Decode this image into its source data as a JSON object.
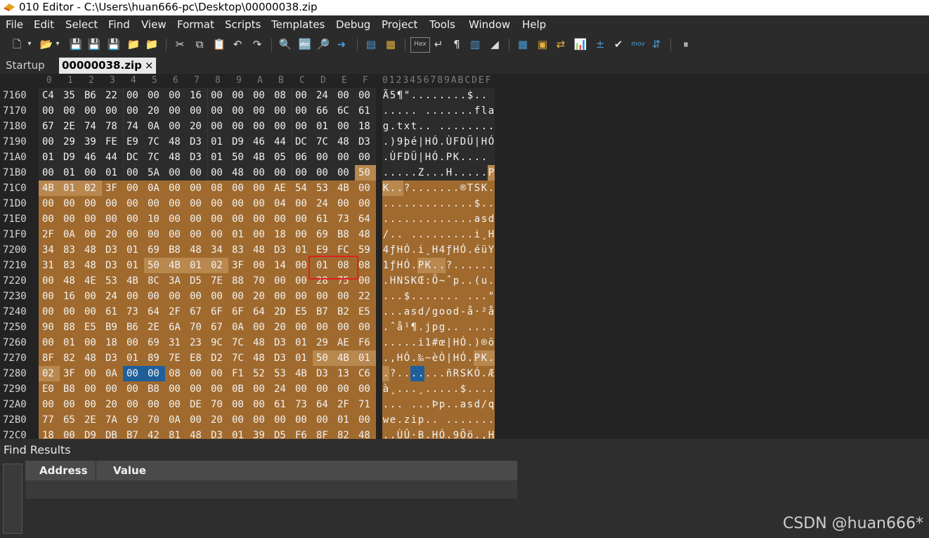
{
  "window": {
    "title": "010 Editor - C:\\Users\\huan666-pc\\Desktop\\00000038.zip"
  },
  "menu": [
    "File",
    "Edit",
    "Select",
    "Find",
    "View",
    "Format",
    "Scripts",
    "Templates",
    "Debug",
    "Project",
    "Tools",
    "Window",
    "Help"
  ],
  "toolbar": {
    "hex_label": "Hex",
    "mov_label": "mov"
  },
  "tabs": {
    "startup": "Startup",
    "active": "00000038.zip",
    "close_glyph": "×"
  },
  "hex": {
    "col_headers": [
      "0",
      "1",
      "2",
      "3",
      "4",
      "5",
      "6",
      "7",
      "8",
      "9",
      "A",
      "B",
      "C",
      "D",
      "E",
      "F"
    ],
    "ascii_header": "0123456789ABCDEF",
    "rows": [
      {
        "addr": "7160",
        "bytes": [
          "C4",
          "35",
          "B6",
          "22",
          "00",
          "00",
          "00",
          "16",
          "00",
          "00",
          "00",
          "08",
          "00",
          "24",
          "00",
          "00"
        ],
        "ascii": "Ä5¶\"........$.."
      },
      {
        "addr": "7170",
        "bytes": [
          "00",
          "00",
          "00",
          "00",
          "00",
          "20",
          "00",
          "00",
          "00",
          "00",
          "00",
          "00",
          "00",
          "66",
          "6C",
          "61"
        ],
        "ascii": "..... .......fla"
      },
      {
        "addr": "7180",
        "bytes": [
          "67",
          "2E",
          "74",
          "78",
          "74",
          "0A",
          "00",
          "20",
          "00",
          "00",
          "00",
          "00",
          "00",
          "01",
          "00",
          "18"
        ],
        "ascii": "g.txt.. ........"
      },
      {
        "addr": "7190",
        "bytes": [
          "00",
          "29",
          "39",
          "FE",
          "E9",
          "7C",
          "48",
          "D3",
          "01",
          "D9",
          "46",
          "44",
          "DC",
          "7C",
          "48",
          "D3"
        ],
        "ascii": ".)9þé|HÓ.ÙFDÜ|HÓ"
      },
      {
        "addr": "71A0",
        "bytes": [
          "01",
          "D9",
          "46",
          "44",
          "DC",
          "7C",
          "48",
          "D3",
          "01",
          "50",
          "4B",
          "05",
          "06",
          "00",
          "00",
          "00"
        ],
        "ascii": ".ÙFDÜ|HÓ.PK...."
      },
      {
        "addr": "71B0",
        "bytes": [
          "00",
          "01",
          "00",
          "01",
          "00",
          "5A",
          "00",
          "00",
          "00",
          "48",
          "00",
          "00",
          "00",
          "00",
          "00",
          "50"
        ],
        "ascii": ".....Z...H.....P"
      },
      {
        "addr": "71C0",
        "bytes": [
          "4B",
          "01",
          "02",
          "3F",
          "00",
          "0A",
          "00",
          "00",
          "08",
          "00",
          "00",
          "AE",
          "54",
          "53",
          "4B",
          "00"
        ],
        "ascii": "K..?.......®TSK."
      },
      {
        "addr": "71D0",
        "bytes": [
          "00",
          "00",
          "00",
          "00",
          "00",
          "00",
          "00",
          "00",
          "00",
          "00",
          "00",
          "04",
          "00",
          "24",
          "00",
          "00"
        ],
        "ascii": ".............$.."
      },
      {
        "addr": "71E0",
        "bytes": [
          "00",
          "00",
          "00",
          "00",
          "00",
          "10",
          "00",
          "00",
          "00",
          "00",
          "00",
          "00",
          "00",
          "61",
          "73",
          "64"
        ],
        "ascii": ".............asd"
      },
      {
        "addr": "71F0",
        "bytes": [
          "2F",
          "0A",
          "00",
          "20",
          "00",
          "00",
          "00",
          "00",
          "00",
          "01",
          "00",
          "18",
          "00",
          "69",
          "B8",
          "48"
        ],
        "ascii": "/.. .........i¸H"
      },
      {
        "addr": "7200",
        "bytes": [
          "34",
          "83",
          "48",
          "D3",
          "01",
          "69",
          "B8",
          "48",
          "34",
          "83",
          "48",
          "D3",
          "01",
          "E9",
          "FC",
          "59"
        ],
        "ascii": "4ƒHÓ.i¸H4ƒHÓ.éüY"
      },
      {
        "addr": "7210",
        "bytes": [
          "31",
          "83",
          "48",
          "D3",
          "01",
          "50",
          "4B",
          "01",
          "02",
          "3F",
          "00",
          "14",
          "00",
          "01",
          "08",
          "08"
        ],
        "ascii": "1ƒHÓ.PK..?......"
      },
      {
        "addr": "7220",
        "bytes": [
          "00",
          "48",
          "4E",
          "53",
          "4B",
          "8C",
          "3A",
          "D5",
          "7E",
          "88",
          "70",
          "00",
          "00",
          "28",
          "75",
          "00"
        ],
        "ascii": ".HNSKŒ:Õ~ˆp..(u."
      },
      {
        "addr": "7230",
        "bytes": [
          "00",
          "16",
          "00",
          "24",
          "00",
          "00",
          "00",
          "00",
          "00",
          "00",
          "20",
          "00",
          "00",
          "00",
          "00",
          "22"
        ],
        "ascii": "...$....... ...\""
      },
      {
        "addr": "7240",
        "bytes": [
          "00",
          "00",
          "00",
          "61",
          "73",
          "64",
          "2F",
          "67",
          "6F",
          "6F",
          "64",
          "2D",
          "E5",
          "B7",
          "B2",
          "E5"
        ],
        "ascii": "...asd/good-å·²å"
      },
      {
        "addr": "7250",
        "bytes": [
          "90",
          "88",
          "E5",
          "B9",
          "B6",
          "2E",
          "6A",
          "70",
          "67",
          "0A",
          "00",
          "20",
          "00",
          "00",
          "00",
          "00"
        ],
        "ascii": ".ˆå¹¶.jpg.. ...."
      },
      {
        "addr": "7260",
        "bytes": [
          "00",
          "01",
          "00",
          "18",
          "00",
          "69",
          "31",
          "23",
          "9C",
          "7C",
          "48",
          "D3",
          "01",
          "29",
          "AE",
          "F6"
        ],
        "ascii": ".....i1#œ|HÓ.)®ö"
      },
      {
        "addr": "7270",
        "bytes": [
          "8F",
          "82",
          "48",
          "D3",
          "01",
          "89",
          "7E",
          "E8",
          "D2",
          "7C",
          "48",
          "D3",
          "01",
          "50",
          "4B",
          "01"
        ],
        "ascii": ".‚HÓ.‰~èÒ|HÓ.PK."
      },
      {
        "addr": "7280",
        "bytes": [
          "02",
          "3F",
          "00",
          "0A",
          "00",
          "00",
          "08",
          "00",
          "00",
          "F1",
          "52",
          "53",
          "4B",
          "D3",
          "13",
          "C6"
        ],
        "ascii": ".?.......ñRSKÓ.Æ"
      },
      {
        "addr": "7290",
        "bytes": [
          "E0",
          "B8",
          "00",
          "00",
          "00",
          "B8",
          "00",
          "00",
          "00",
          "0B",
          "00",
          "24",
          "00",
          "00",
          "00",
          "00"
        ],
        "ascii": "à¸...¸.....$...."
      },
      {
        "addr": "72A0",
        "bytes": [
          "00",
          "00",
          "00",
          "20",
          "00",
          "00",
          "00",
          "DE",
          "70",
          "00",
          "00",
          "61",
          "73",
          "64",
          "2F",
          "71"
        ],
        "ascii": "... ...Þp..asd/q"
      },
      {
        "addr": "72B0",
        "bytes": [
          "77",
          "65",
          "2E",
          "7A",
          "69",
          "70",
          "0A",
          "00",
          "20",
          "00",
          "00",
          "00",
          "00",
          "00",
          "01",
          "00"
        ],
        "ascii": "we.zip.. ......."
      },
      {
        "addr": "72C0",
        "bytes": [
          "18",
          "00",
          "D9",
          "DB",
          "B7",
          "42",
          "81",
          "48",
          "D3",
          "01",
          "39",
          "D5",
          "F6",
          "8F",
          "82",
          "48"
        ],
        "ascii": "..ÙÛ·B.HÓ.9Õö.‚H"
      }
    ]
  },
  "find_results": {
    "title": "Find Results",
    "columns": [
      "Address",
      "Value"
    ]
  },
  "watermark": "CSDN @huan666*"
}
